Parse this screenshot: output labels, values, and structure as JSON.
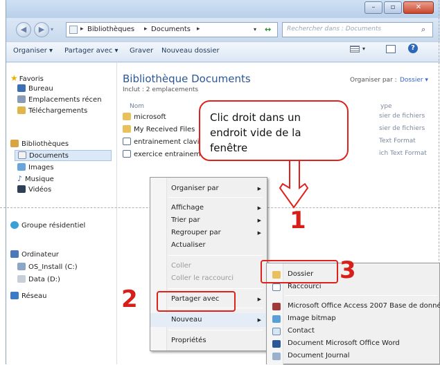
{
  "address_bar": {
    "breadcrumb_1": "Bibliothèques",
    "breadcrumb_2": "Documents",
    "search_placeholder": "Rechercher dans : Documents"
  },
  "toolbar": {
    "organiser": "Organiser ▾",
    "partager": "Partager avec ▾",
    "graver": "Graver",
    "nouveau_dossier": "Nouveau dossier"
  },
  "sidebar": {
    "favoris": "Favoris",
    "bureau": "Bureau",
    "emplacements": "Emplacements récen",
    "telechargements": "Téléchargements",
    "bibliotheques": "Bibliothèques",
    "documents": "Documents",
    "images": "Images",
    "musique": "Musique",
    "videos": "Vidéos",
    "groupe": "Groupe résidentiel",
    "ordinateur": "Ordinateur",
    "os_install": "OS_Install (C:)",
    "data": "Data (D:)",
    "reseau": "Réseau"
  },
  "library": {
    "title": "Bibliothèque Documents",
    "includes": "Inclut : 2 emplacements",
    "arrange_label": "Organiser par :",
    "arrange_value": "Dossier ▾",
    "col_name": "Nom",
    "col_type": "ype"
  },
  "files": [
    {
      "name": "microsoft",
      "type": "sier de fichiers"
    },
    {
      "name": "My Received Files",
      "type": "sier de fichiers"
    },
    {
      "name": "entrainement clavier",
      "type": "Text Format"
    },
    {
      "name": "exercice entrainement",
      "type": "ich Text Format"
    }
  ],
  "callout": {
    "text": "Clic droit dans un endroit vide de la fenêtre"
  },
  "context_menu": {
    "organiser_par": "Organiser par",
    "affichage": "Affichage",
    "trier_par": "Trier par",
    "regrouper_par": "Regrouper par",
    "actualiser": "Actualiser",
    "coller": "Coller",
    "coller_raccourci": "Coller le raccourci",
    "partager_avec": "Partager avec",
    "nouveau": "Nouveau",
    "proprietes": "Propriétés"
  },
  "submenu": {
    "dossier": "Dossier",
    "raccourci": "Raccourci",
    "access": "Microsoft Office Access 2007 Base de donné",
    "bitmap": "Image bitmap",
    "contact": "Contact",
    "word": "Document Microsoft Office Word",
    "journal": "Document Journal"
  },
  "annotations": {
    "step1": "1",
    "step2": "2",
    "step3": "3"
  },
  "colors": {
    "accent_red": "#e0201b",
    "library_title": "#2b5797",
    "link_blue": "#3366cc"
  }
}
